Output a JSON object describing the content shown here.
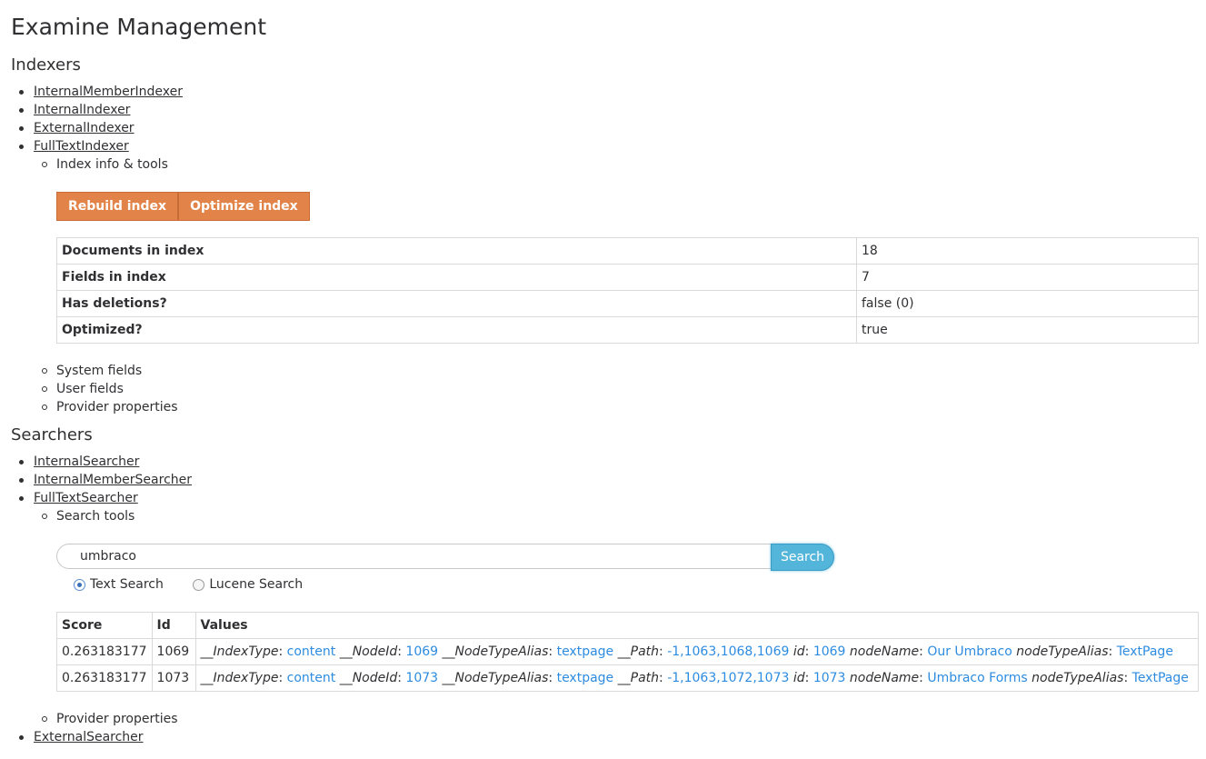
{
  "page_title": "Examine Management",
  "indexers": {
    "heading": "Indexers",
    "items": [
      "InternalMemberIndexer",
      "InternalIndexer",
      "ExternalIndexer",
      "FullTextIndexer"
    ],
    "sub_info": "Index info & tools",
    "rebuild_label": "Rebuild index",
    "optimize_label": "Optimize index",
    "info_rows": [
      {
        "label": "Documents in index",
        "value": "18"
      },
      {
        "label": "Fields in index",
        "value": "7"
      },
      {
        "label": "Has deletions?",
        "value": "false (0)"
      },
      {
        "label": "Optimized?",
        "value": "true"
      }
    ],
    "sub_items": [
      "System fields",
      "User fields",
      "Provider properties"
    ]
  },
  "searchers": {
    "heading": "Searchers",
    "items": [
      "InternalSearcher",
      "InternalMemberSearcher",
      "FullTextSearcher"
    ],
    "sub_search_tools": "Search tools",
    "search_value": "umbraco",
    "search_button": "Search",
    "radio_text": "Text Search",
    "radio_lucene": "Lucene Search",
    "columns": [
      "Score",
      "Id",
      "Values"
    ],
    "results": [
      {
        "score": "0.263183177",
        "id": "1069",
        "index_type": "content",
        "node_id": "1069",
        "node_type_alias": "textpage",
        "path": "-1,1063,1068,1069",
        "id_val": "1069",
        "node_name": "Our Umbraco",
        "node_type_alias2": "TextPage"
      },
      {
        "score": "0.263183177",
        "id": "1073",
        "index_type": "content",
        "node_id": "1073",
        "node_type_alias": "textpage",
        "path": "-1,1063,1072,1073",
        "id_val": "1073",
        "node_name": "Umbraco Forms",
        "node_type_alias2": "TextPage"
      }
    ],
    "field_labels": {
      "index_type": "__IndexType",
      "node_id": "__NodeId",
      "node_type_alias": "__NodeTypeAlias",
      "path": "__Path",
      "id": "id",
      "node_name": "nodeName",
      "node_type_alias2": "nodeTypeAlias"
    },
    "sub_provider": "Provider properties",
    "last_item": "ExternalSearcher"
  },
  "colors": {
    "accent_orange": "#e2844a",
    "search_blue": "#53b5da",
    "link_blue": "#2d8ce0"
  }
}
